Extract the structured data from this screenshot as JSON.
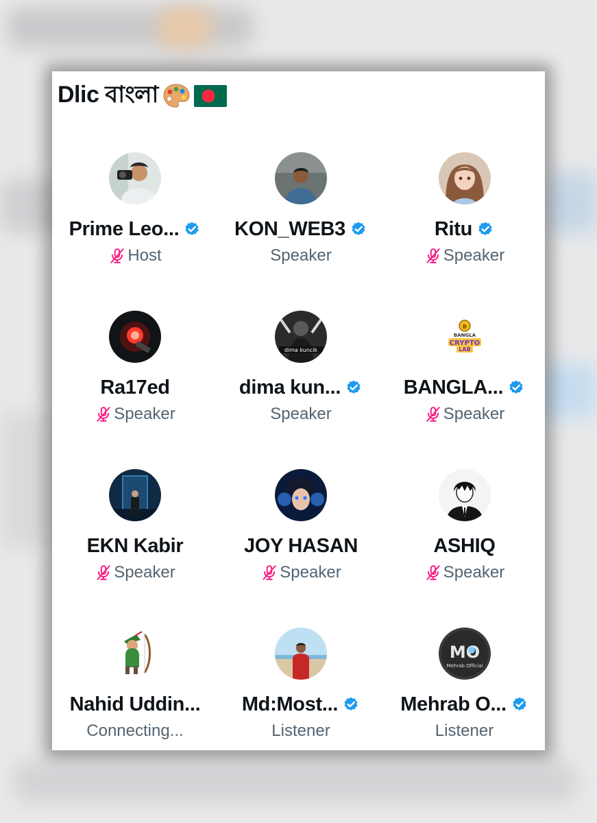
{
  "space": {
    "title": "Dlic বাংলা",
    "title_emoji": [
      "artist-palette-icon",
      "bangladesh-flag-icon"
    ]
  },
  "colors": {
    "verified": "#1d9bf0",
    "muted_mic": "#f91880",
    "role_text": "#536471",
    "name_text": "#0f1419"
  },
  "participants": [
    {
      "name": "Prime Leo...",
      "role": "Host",
      "verified": true,
      "muted": true,
      "avatar": "man-with-camera-photo"
    },
    {
      "name": "KON_WEB3",
      "role": "Speaker",
      "verified": true,
      "muted": false,
      "avatar": "man-portrait-photo"
    },
    {
      "name": "Ritu",
      "role": "Speaker",
      "verified": true,
      "muted": true,
      "avatar": "anime-girl-illustration"
    },
    {
      "name": "Ra17ed",
      "role": "Speaker",
      "verified": false,
      "muted": true,
      "avatar": "red-glowing-bulb"
    },
    {
      "name": "dima kun...",
      "role": "Speaker",
      "verified": true,
      "muted": false,
      "avatar": "dima-kuncik-logo"
    },
    {
      "name": "BANGLA...",
      "role": "Speaker",
      "verified": true,
      "muted": true,
      "avatar": "bangla-crypto-lab-logo"
    },
    {
      "name": "EKN Kabir",
      "role": "Speaker",
      "verified": false,
      "muted": true,
      "avatar": "man-in-doorway-art"
    },
    {
      "name": "JOY HASAN",
      "role": "Speaker",
      "verified": false,
      "muted": true,
      "avatar": "anime-boy-blue-art"
    },
    {
      "name": "ASHIQ",
      "role": "Speaker",
      "verified": false,
      "muted": true,
      "avatar": "anime-boy-sketch"
    },
    {
      "name": "Nahid Uddin...",
      "role": "Connecting...",
      "verified": false,
      "muted": false,
      "avatar": "robin-hood-cartoon"
    },
    {
      "name": "Md:Most...",
      "role": "Listener",
      "verified": true,
      "muted": false,
      "avatar": "man-on-beach-photo"
    },
    {
      "name": "Mehrab O...",
      "role": "Listener",
      "verified": true,
      "muted": false,
      "avatar": "mehrab-official-logo"
    }
  ]
}
